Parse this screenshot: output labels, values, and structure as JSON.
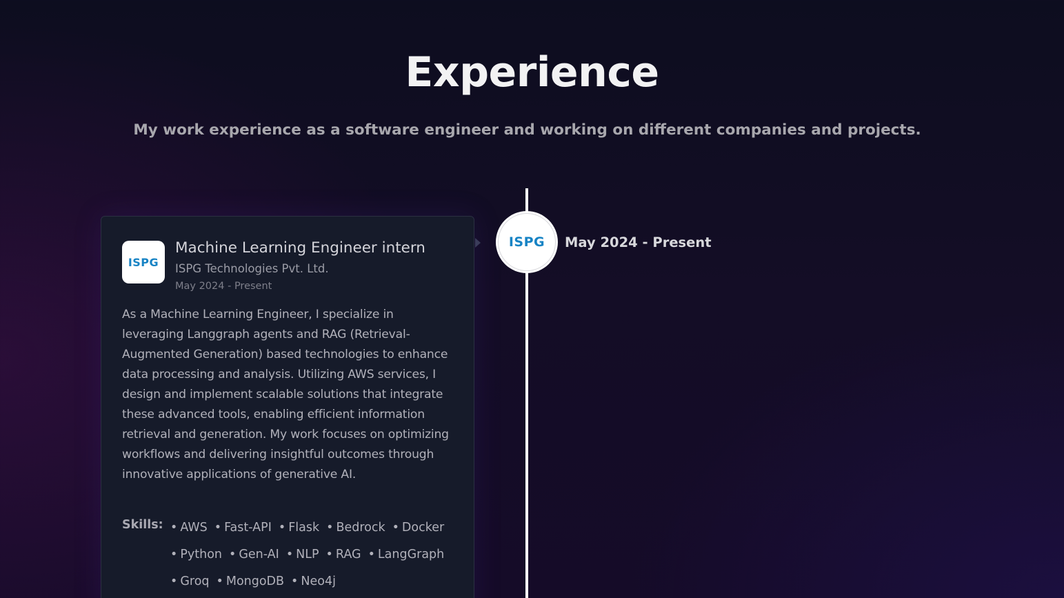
{
  "header": {
    "title": "Experience",
    "subtitle": "My work experience as a software engineer and working on different companies and projects."
  },
  "timeline": {
    "node_logo_text": "ISPG",
    "date": "May 2024 - Present"
  },
  "experience": {
    "logo_text": "ISPG",
    "role": "Machine Learning Engineer intern",
    "company": "ISPG Technologies Pvt. Ltd.",
    "date": "May 2024 - Present",
    "description": "As a Machine Learning Engineer, I specialize in leveraging Langgraph agents and RAG (Retrieval-Augmented Generation) based technologies to enhance data processing and analysis. Utilizing AWS services, I design and implement scalable solutions that integrate these advanced tools, enabling efficient information retrieval and generation. My work focuses on optimizing workflows and delivering insightful outcomes through innovative applications of generative AI.",
    "skills_label": "Skills:",
    "skills": [
      "AWS",
      "Fast-API",
      "Flask",
      "Bedrock",
      "Docker",
      "Python",
      "Gen-AI",
      "NLP",
      "RAG",
      "LangGraph",
      "Groq",
      "MongoDB",
      "Neo4j"
    ]
  },
  "colors": {
    "accent_logo": "#1783c4",
    "timeline_line": "#ffffff",
    "card_background": "#161b2a"
  }
}
